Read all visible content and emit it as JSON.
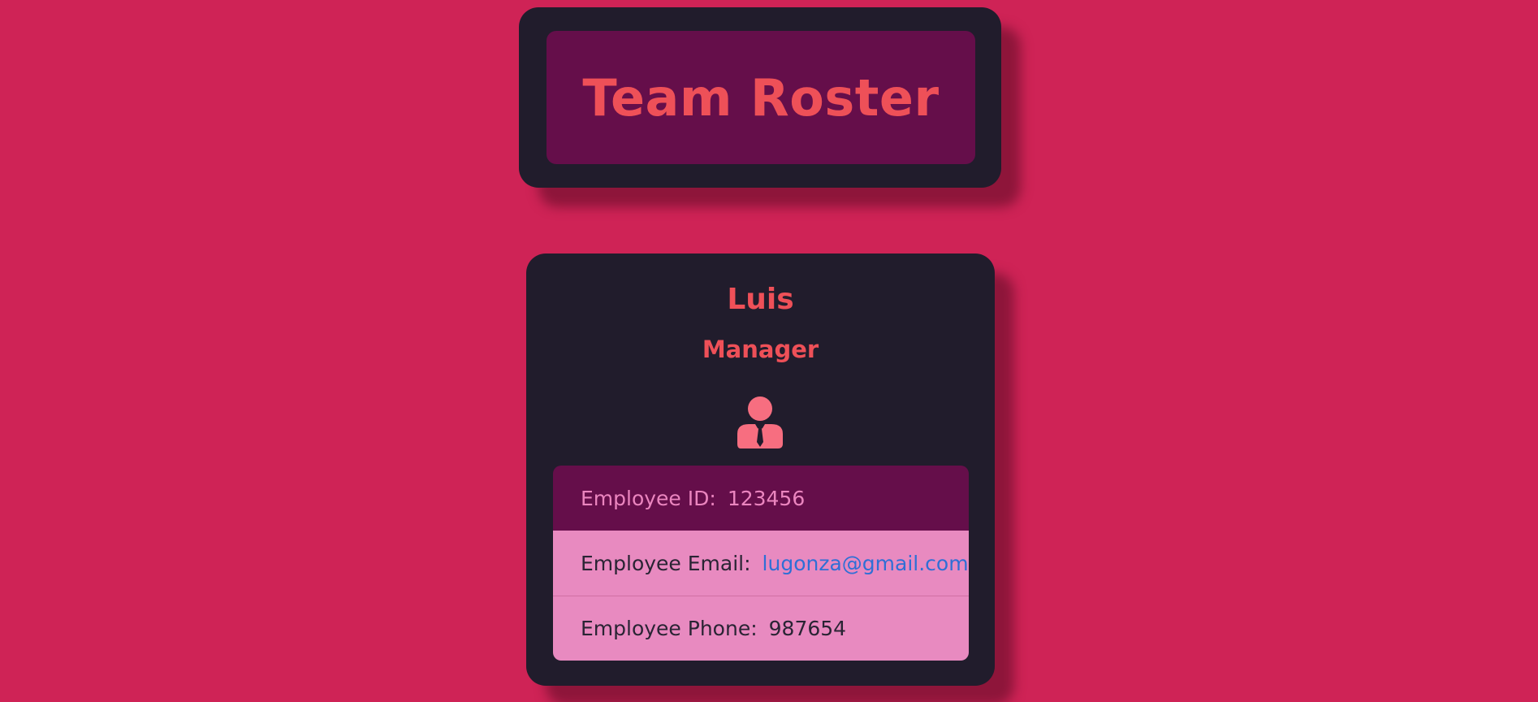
{
  "header": {
    "title": "Team Roster"
  },
  "employee": {
    "name": "Luis",
    "role": "Manager",
    "icon": "manager-icon",
    "id_label": "Employee ID:",
    "id_value": "123456",
    "email_label": "Employee Email:",
    "email_value": "lugonza@gmail.com",
    "email_href": "mailto:lugonza@gmail.com",
    "phone_label": "Employee Phone:",
    "phone_value": "987654"
  },
  "colors": {
    "background": "#cf2356",
    "card": "#211c2c",
    "accent_dark": "#650e4a",
    "accent_text": "#ee5058",
    "row_light": "#e88ac0",
    "link": "#2f6fd6"
  }
}
